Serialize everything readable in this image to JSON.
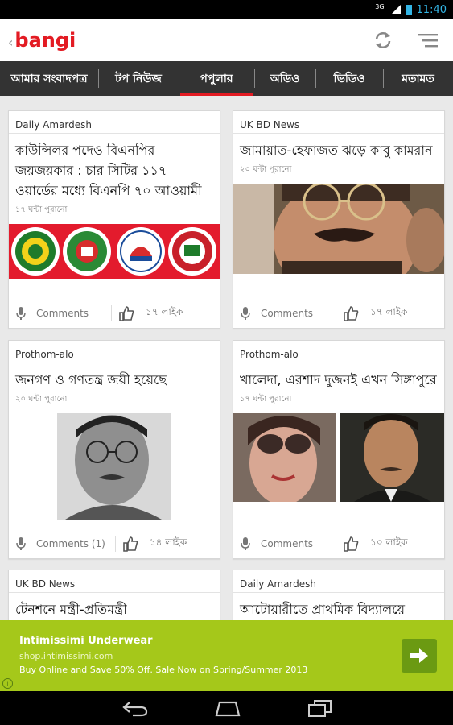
{
  "status_bar": {
    "network": "3G",
    "time": "11:40"
  },
  "app": {
    "logo_text": "bangi",
    "logo_color": "#e31b23"
  },
  "tabs": [
    {
      "label": "আমার সংবাদপত্র"
    },
    {
      "label": "টপ নিউজ"
    },
    {
      "label": "পপুলার",
      "active": true
    },
    {
      "label": "অডিও"
    },
    {
      "label": "ভিডিও"
    },
    {
      "label": "মতামত"
    }
  ],
  "cards": [
    {
      "source": "Daily Amardesh",
      "headline": "কাউন্সিলর পদেও বিএনপির জয়জয়কার : চার সিটির ১১৭ ওয়ার্ডের মধ্যে বিএনপি ৭০ আওয়ামী",
      "time": "১৭ ঘন্টা পুরানো",
      "comments": "Comments",
      "likes": "১৭ লাইক",
      "image": "party-logos"
    },
    {
      "source": "UK BD News",
      "headline": "জামায়াত-হেফাজত ঝড়ে কাবু কামরান",
      "time": "২০ ঘন্টা পুরানো",
      "comments": "Comments",
      "likes": "১৭ লাইক",
      "image": "man-glasses-photo"
    },
    {
      "source": "Prothom-alo",
      "headline": "জনগণ ও গণতন্ত্র জয়ী হয়েছে",
      "time": "২০ ঘন্টা পুরানো",
      "comments": "Comments (1)",
      "likes": "১৪ লাইক",
      "image": "man-portrait-bw"
    },
    {
      "source": "Prothom-alo",
      "headline": "খালেদা, এরশাদ দুজনই এখন সিঙ্গাপুরে",
      "time": "১৭ ঘন্টা পুরানো",
      "comments": "Comments",
      "likes": "১০ লাইক",
      "image": "two-portraits"
    },
    {
      "source": "UK BD News",
      "headline": "টেনশনে মন্ত্রী-প্রতিমন্ত্রী",
      "time": "",
      "comments": "",
      "likes": "",
      "image": ""
    },
    {
      "source": "Daily Amardesh",
      "headline": "আটোয়ারীতে প্রাথমিক বিদ্যালয়ে",
      "time": "",
      "comments": "",
      "likes": "",
      "image": ""
    }
  ],
  "ad": {
    "title": "Intimissimi Underwear",
    "url": "shop.intimissimi.com",
    "text": "Buy Online and Save 50% Off. Sale Now on Spring/Summer 2013",
    "color": "#a5c81a"
  }
}
